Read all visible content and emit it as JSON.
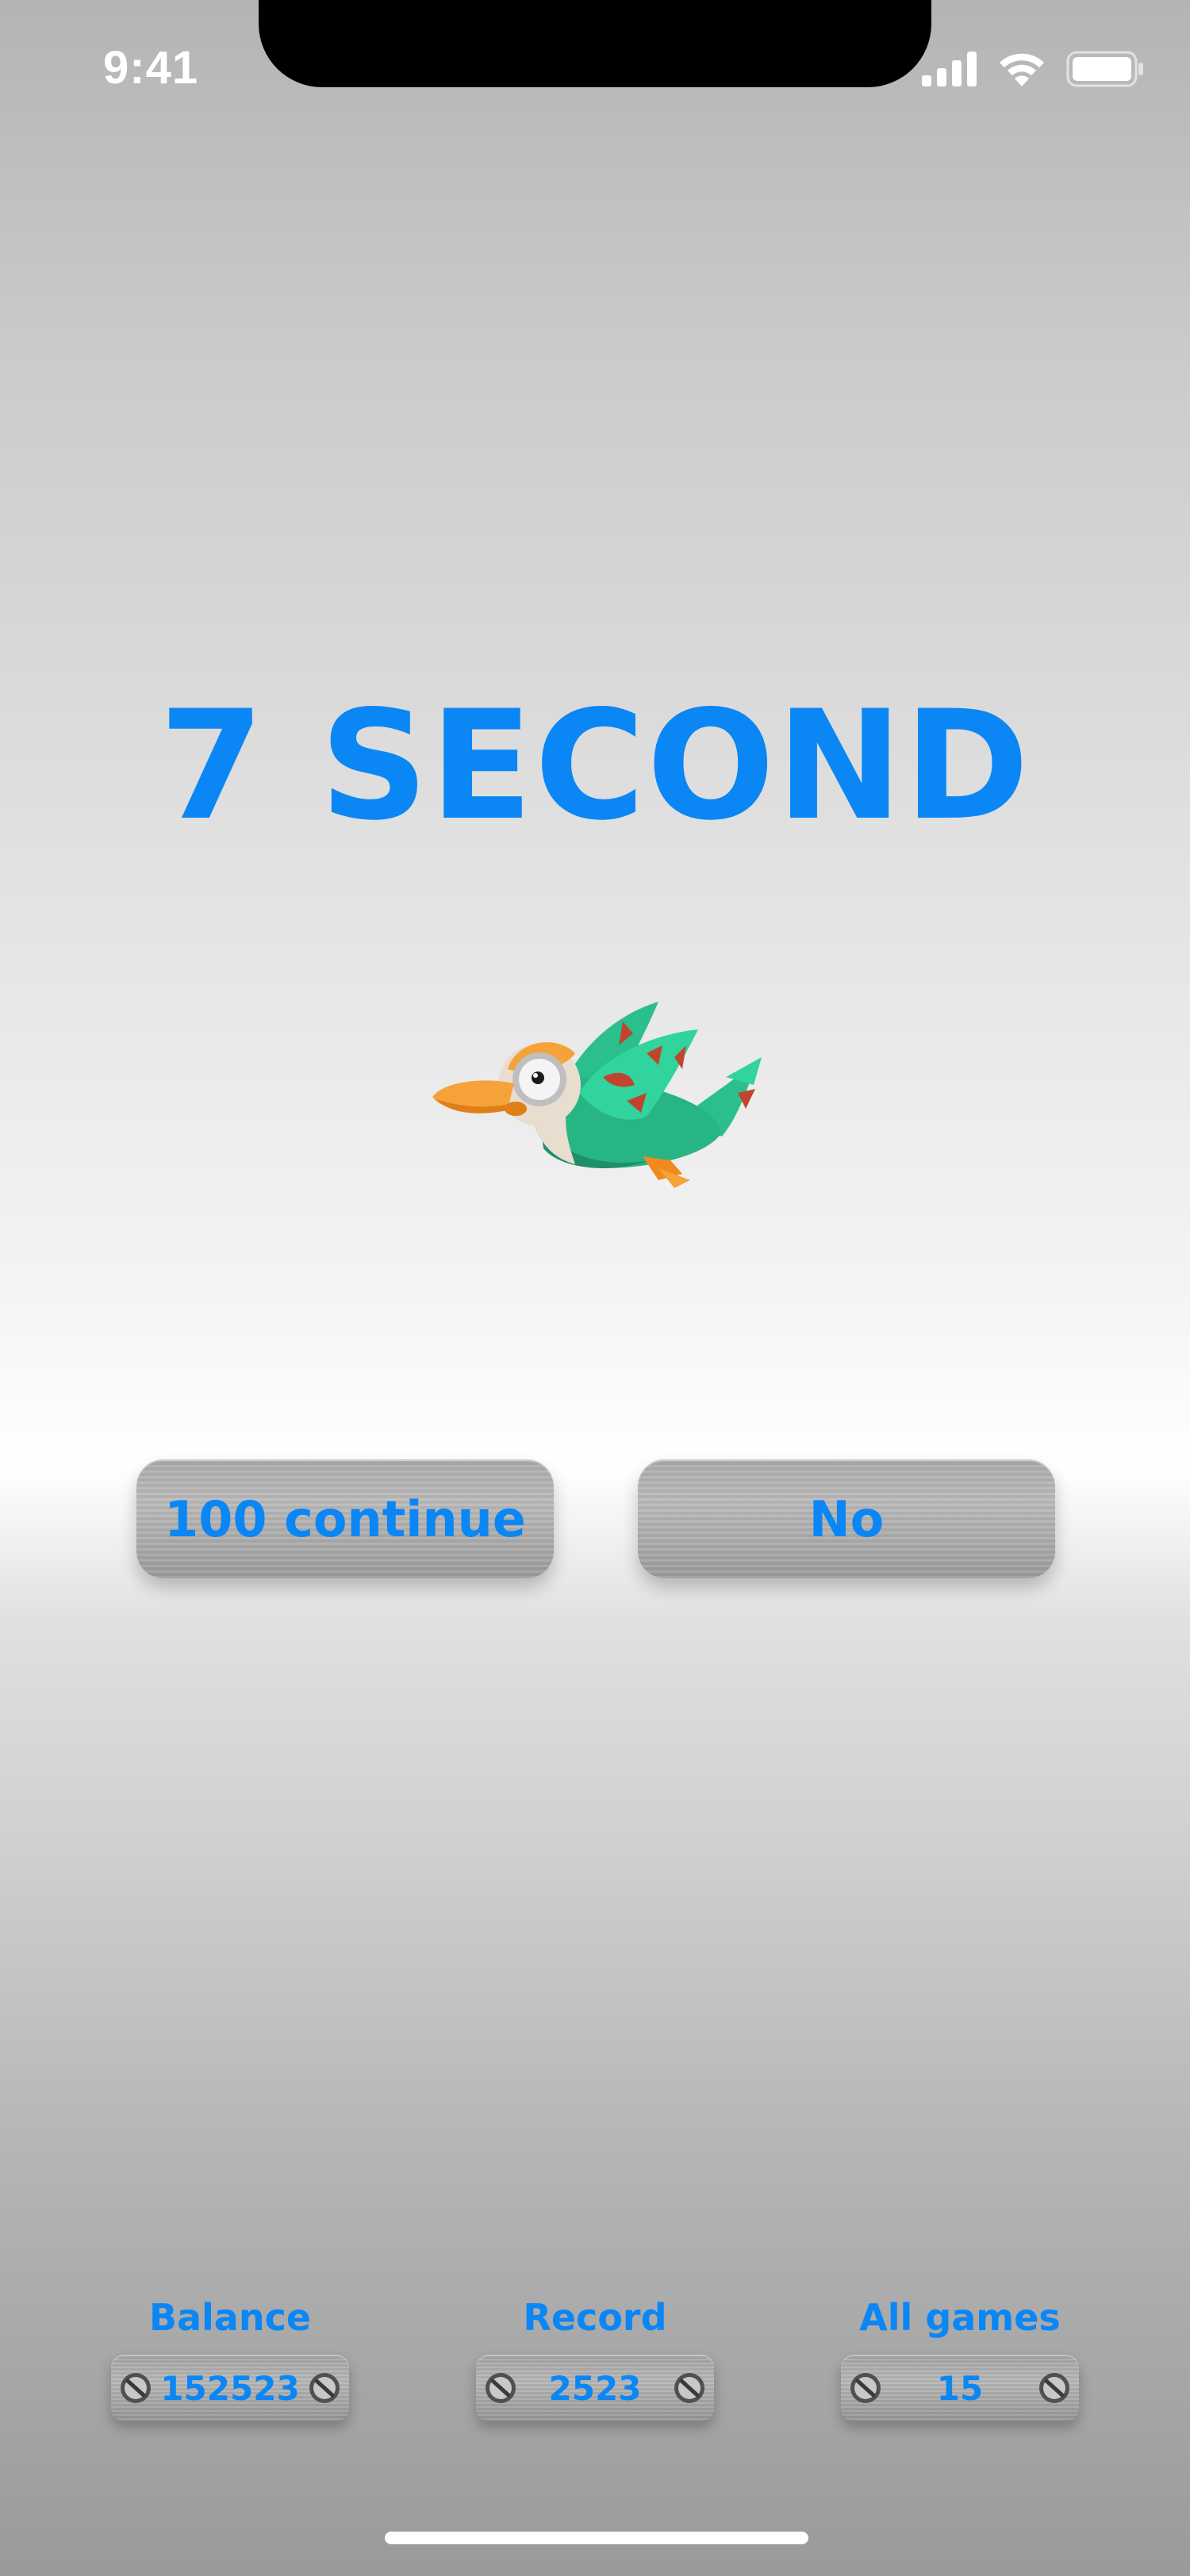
{
  "status_bar": {
    "time": "9:41",
    "icons": [
      "signal-icon",
      "wifi-icon",
      "battery-icon"
    ]
  },
  "game": {
    "countdown": "7 SECOND",
    "character": "duck-icon"
  },
  "actions": {
    "continue_label": "100 continue",
    "no_label": "No"
  },
  "stats": {
    "balance": {
      "label": "Balance",
      "value": "152523"
    },
    "record": {
      "label": "Record",
      "value": "2523"
    },
    "all_games": {
      "label": "All games",
      "value": "15"
    }
  },
  "colors": {
    "accent": "#0a86f5",
    "plate": "#aaaaaa"
  }
}
